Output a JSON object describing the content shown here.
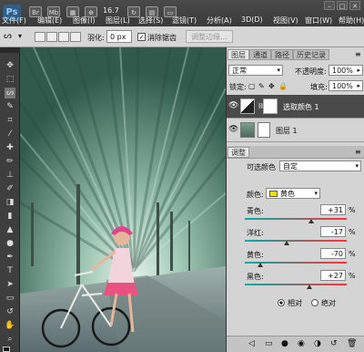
{
  "app": {
    "logo": "Ps",
    "zoom": "16.7"
  },
  "menu": [
    {
      "label": "文件(F)"
    },
    {
      "label": "编辑(E)"
    },
    {
      "label": "图像(I)"
    },
    {
      "label": "图层(L)"
    },
    {
      "label": "选择(S)"
    },
    {
      "label": "滤镜(T)"
    },
    {
      "label": "分析(A)"
    },
    {
      "label": "3D(D)"
    },
    {
      "label": "视图(V)"
    },
    {
      "label": "窗口(W)"
    },
    {
      "label": "帮助(H)"
    }
  ],
  "options": {
    "feather_label": "羽化:",
    "feather_value": "0 px",
    "antialias_label": "消除锯齿",
    "refine_label": "调整边缘..."
  },
  "layers_panel": {
    "tabs": [
      "图层",
      "通道",
      "路径",
      "历史记录"
    ],
    "blend_mode": "正常",
    "opacity_label": "不透明度:",
    "opacity_value": "100%",
    "lock_label": "锁定:",
    "fill_label": "填充:",
    "fill_value": "100%",
    "layers": [
      {
        "name": "选取颜色 1",
        "selected": true
      },
      {
        "name": "图层 1",
        "selected": false
      }
    ]
  },
  "adjustments": {
    "tab": "调整",
    "title": "可选颜色",
    "preset": "自定",
    "colors_label": "颜色:",
    "color_value": "黄色",
    "color_swatch": "#f5e400",
    "sliders": [
      {
        "label": "青色:",
        "value": "+31",
        "pct": 0.655
      },
      {
        "label": "洋红:",
        "value": "-17",
        "pct": 0.415
      },
      {
        "label": "黄色:",
        "value": "-70",
        "pct": 0.15
      },
      {
        "label": "黑色:",
        "value": "+27",
        "pct": 0.635
      }
    ],
    "unit": "%",
    "radio_relative": "相对",
    "radio_absolute": "绝对"
  }
}
